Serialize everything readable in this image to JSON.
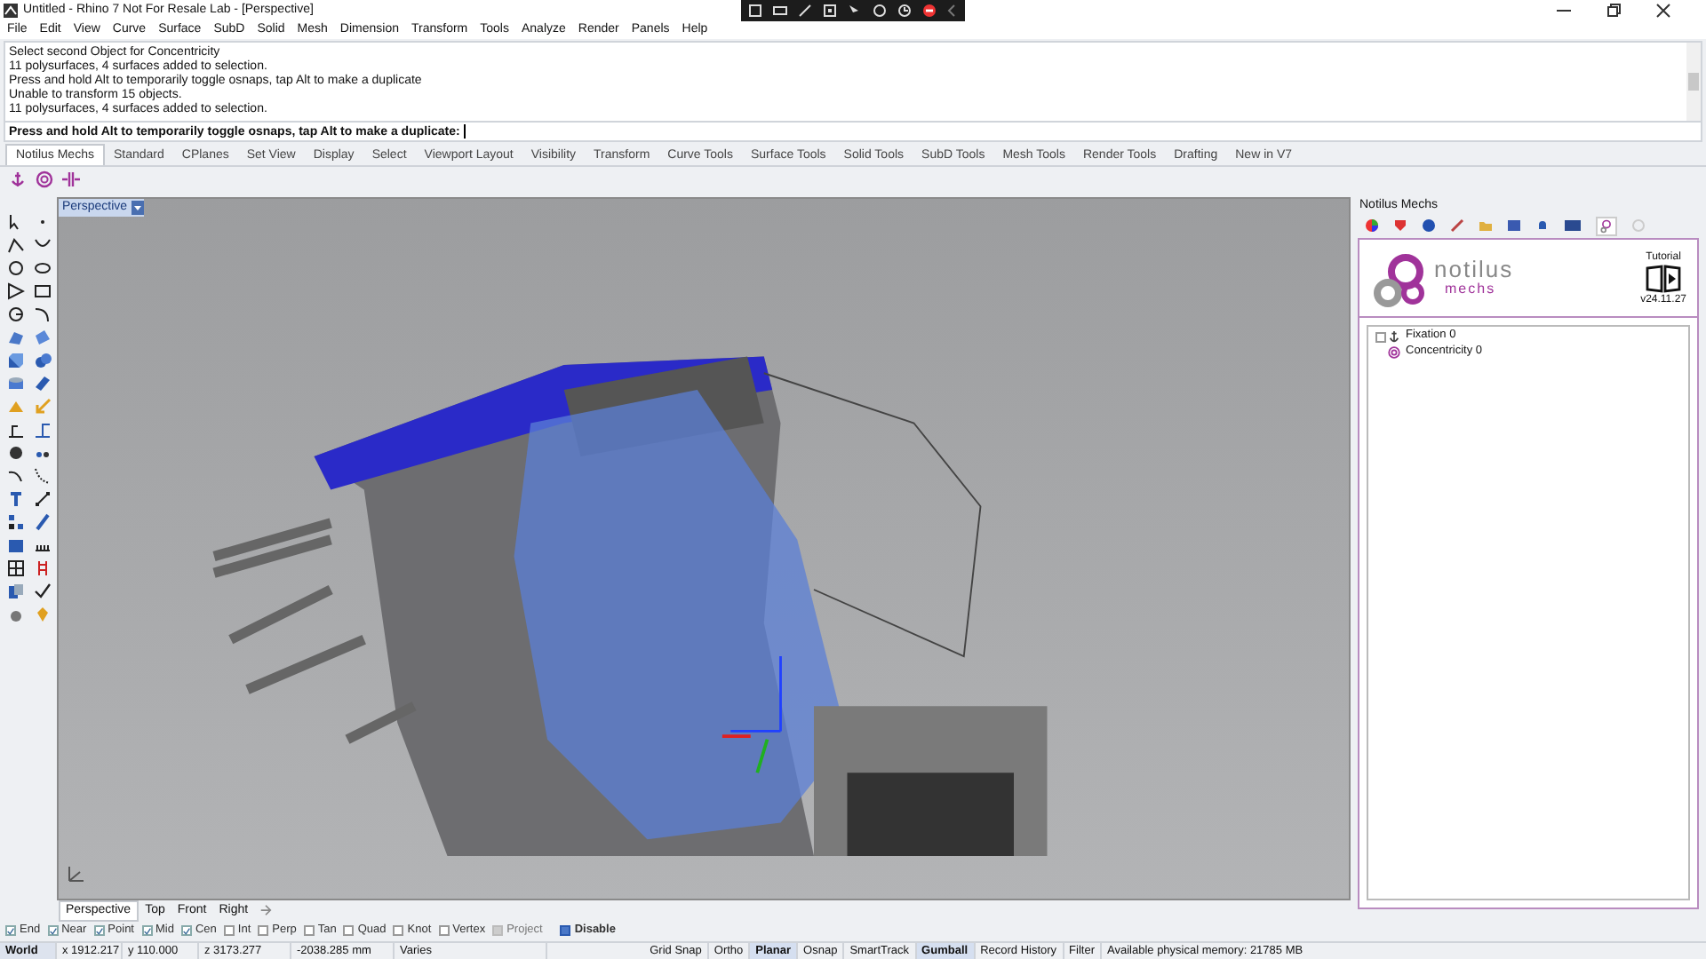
{
  "window": {
    "title": "Untitled - Rhino 7 Not For Resale Lab - [Perspective]"
  },
  "menu": [
    "File",
    "Edit",
    "View",
    "Curve",
    "Surface",
    "SubD",
    "Solid",
    "Mesh",
    "Dimension",
    "Transform",
    "Tools",
    "Analyze",
    "Render",
    "Panels",
    "Help"
  ],
  "command_history": [
    "Select second Object for Concentricity",
    "11 polysurfaces, 4 surfaces added to selection.",
    "Press and hold Alt to temporarily toggle osnaps, tap Alt to make a duplicate",
    "Unable to transform 15 objects.",
    "11 polysurfaces, 4 surfaces added to selection."
  ],
  "command_prompt": "Press and hold Alt to temporarily toggle osnaps, tap Alt to make a duplicate:",
  "toolbar_tabs": [
    {
      "label": "Notilus Mechs",
      "selected": true
    },
    {
      "label": "Standard",
      "selected": false
    },
    {
      "label": "CPlanes",
      "selected": false
    },
    {
      "label": "Set View",
      "selected": false
    },
    {
      "label": "Display",
      "selected": false
    },
    {
      "label": "Select",
      "selected": false
    },
    {
      "label": "Viewport Layout",
      "selected": false
    },
    {
      "label": "Visibility",
      "selected": false
    },
    {
      "label": "Transform",
      "selected": false
    },
    {
      "label": "Curve Tools",
      "selected": false
    },
    {
      "label": "Surface Tools",
      "selected": false
    },
    {
      "label": "Solid Tools",
      "selected": false
    },
    {
      "label": "SubD Tools",
      "selected": false
    },
    {
      "label": "Mesh Tools",
      "selected": false
    },
    {
      "label": "Render Tools",
      "selected": false
    },
    {
      "label": "Drafting",
      "selected": false
    },
    {
      "label": "New in V7",
      "selected": false
    }
  ],
  "viewport": {
    "label": "Perspective"
  },
  "viewport_tabs": [
    {
      "label": "Perspective",
      "selected": true
    },
    {
      "label": "Top",
      "selected": false
    },
    {
      "label": "Front",
      "selected": false
    },
    {
      "label": "Right",
      "selected": false
    }
  ],
  "panel": {
    "title": "Notilus Mechs",
    "logo_text": "notilus",
    "logo_subtext": "mechs",
    "tutorial": "Tutorial",
    "version": "v24.11.27",
    "tree": [
      {
        "label": "Fixation 0",
        "kind": "fixation",
        "checked": false
      },
      {
        "label": "Concentricity 0",
        "kind": "concentricity"
      }
    ]
  },
  "osnaps": [
    {
      "label": "End",
      "checked": true,
      "disabled": false
    },
    {
      "label": "Near",
      "checked": true,
      "disabled": false
    },
    {
      "label": "Point",
      "checked": true,
      "disabled": false
    },
    {
      "label": "Mid",
      "checked": true,
      "disabled": false
    },
    {
      "label": "Cen",
      "checked": true,
      "disabled": false
    },
    {
      "label": "Int",
      "checked": false,
      "disabled": false
    },
    {
      "label": "Perp",
      "checked": false,
      "disabled": false
    },
    {
      "label": "Tan",
      "checked": false,
      "disabled": false
    },
    {
      "label": "Quad",
      "checked": false,
      "disabled": false
    },
    {
      "label": "Knot",
      "checked": false,
      "disabled": false
    },
    {
      "label": "Vertex",
      "checked": false,
      "disabled": false
    },
    {
      "label": "Project",
      "checked": false,
      "disabled": true
    }
  ],
  "osnap_disable": {
    "label": "Disable",
    "checked": true
  },
  "coordinates": [
    "World",
    "x 1912.217",
    "y 110.000",
    "z 3173.277",
    "-2038.285 mm",
    "Varies"
  ],
  "modes": [
    {
      "label": "Grid Snap",
      "on": false
    },
    {
      "label": "Ortho",
      "on": false
    },
    {
      "label": "Planar",
      "on": true
    },
    {
      "label": "Osnap",
      "on": false
    },
    {
      "label": "SmartTrack",
      "on": false
    },
    {
      "label": "Gumball",
      "on": true
    },
    {
      "label": "Record History",
      "on": false
    },
    {
      "label": "Filter",
      "on": false
    }
  ],
  "memory": "Available physical memory: 21785 MB"
}
